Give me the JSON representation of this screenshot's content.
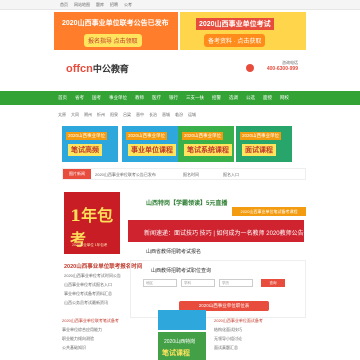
{
  "topbar": {
    "links": [
      "首页",
      "网站地图",
      "题库",
      "招聘",
      "公考"
    ]
  },
  "banners": {
    "left": {
      "line1": "2020山西事业单位联考公告已发布",
      "line2": "报名指导 点击领取"
    },
    "right": {
      "line1": "2020山西事业单位考试",
      "line2": "备考资料 · 点击获取"
    }
  },
  "header": {
    "logo_brand": "offcn",
    "logo_text": "中公教育",
    "city": "山西 ▾",
    "hotline_label": "咨询电话",
    "hotline_number": "400-6300-999"
  },
  "nav": {
    "items": [
      "首页",
      "省考",
      "国考",
      "事业单位",
      "教师",
      "医疗",
      "银行",
      "三支一扶",
      "招警",
      "选调",
      "公选",
      "面授",
      "网校"
    ]
  },
  "subnav": {
    "items": [
      "太原",
      "大同",
      "朔州",
      "忻州",
      "阳泉",
      "吕梁",
      "晋中",
      "长治",
      "晋城",
      "临汾",
      "运城"
    ]
  },
  "promos": [
    {
      "line1": "2020山西事业单位",
      "line2": "笔试高频"
    },
    {
      "line1": "2020山西事业单位",
      "line2": "事业单位课程"
    },
    {
      "line1": "2020山西事业单位",
      "line2": "笔试系统课程"
    },
    {
      "line1": "2020山西事业单位",
      "line2": "面试课程"
    }
  ],
  "ticker": {
    "tag": "图片新闻",
    "items": [
      "2020山西事业单位联考公告已发布",
      "报名时间",
      "报名入口"
    ]
  },
  "poster": {
    "big": "1年包考",
    "small": "2020事业单位 1年包考"
  },
  "news": {
    "heading": "山西特岗【学霸领读】5元直播",
    "badge": "2020山西事业单位笔试备考课程",
    "row1": "新闻速递：面试技巧 技巧 | 如何成为一名教师 2020教师公告汇总",
    "row2": "山西省教师招聘考试报名"
  },
  "news_list": {
    "hot": "2020山西事业单位联考报名时间",
    "rows": [
      "2020山西事业单位考试时间公告",
      "山西事业单位考试报名入口",
      "事业单位考试备考资料汇总",
      "山西公务员考试最新资讯"
    ]
  },
  "form": {
    "title": "山西教师招聘考试职位查询",
    "selects": [
      "地区",
      "学科",
      "学历"
    ],
    "btn": "查询",
    "big_btn": "2020山西事业单位职位表"
  },
  "bottom_news": {
    "left": [
      "2020山西事业单位联考笔试备考",
      "事业单位综合应用能力",
      "职业能力倾向测验",
      "公共基础知识"
    ],
    "right": [
      "2020山西事业单位面试备考",
      "结构化面试技巧",
      "无领导小组讨论",
      "面试真题汇总"
    ]
  },
  "mid_card": {
    "t": "2020山西特岗",
    "t2": "笔试课程"
  }
}
